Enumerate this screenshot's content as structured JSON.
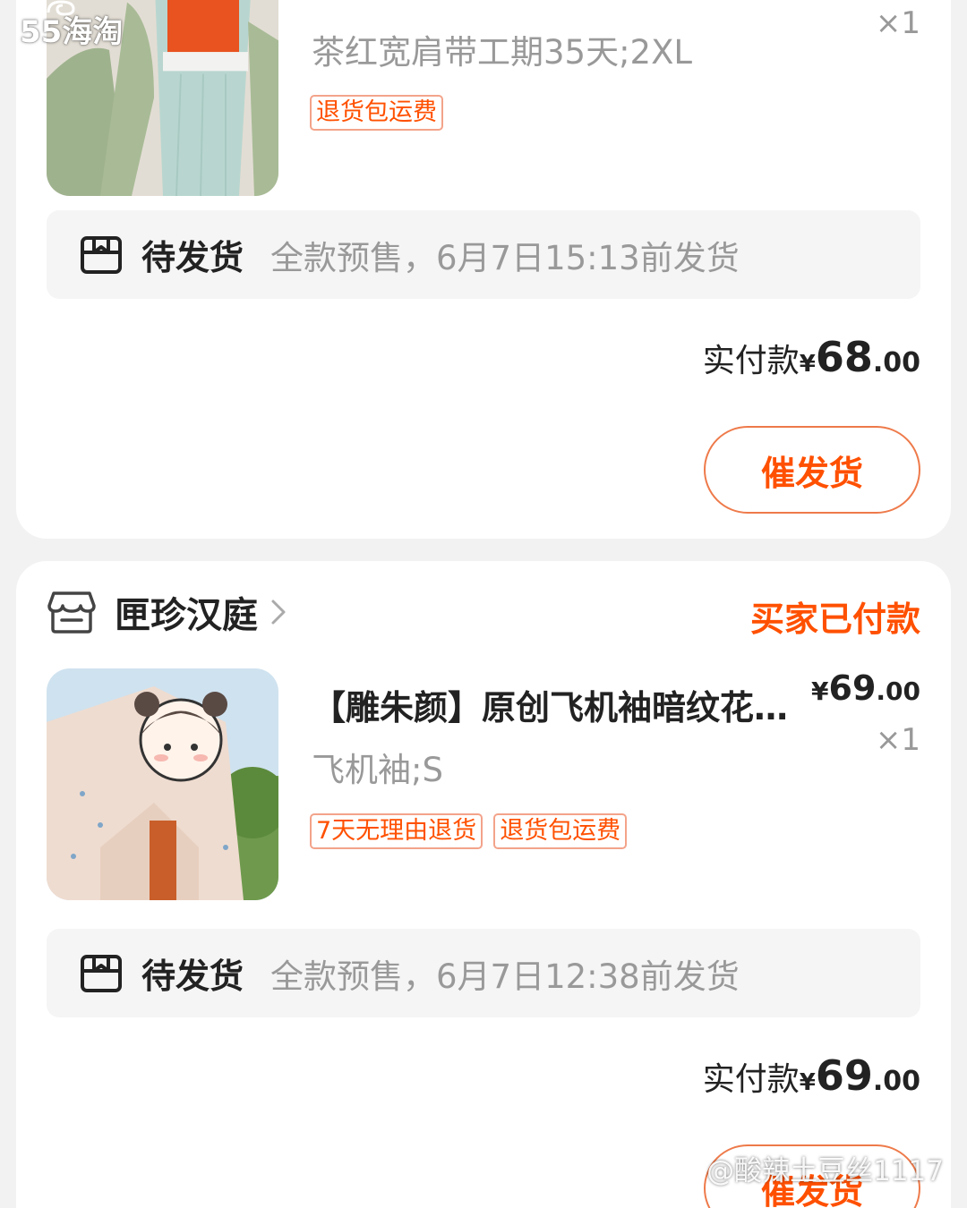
{
  "colors": {
    "accent": "#ff5000",
    "page_bg": "#f2f2f2",
    "muted": "#999999"
  },
  "orders": [
    {
      "product": {
        "sku": "茶红宽肩带工期35天;2XL",
        "qty": "×1",
        "tags": [
          "退货包运费"
        ]
      },
      "shipping": {
        "icon": "package-box-icon",
        "status": "待发货",
        "note": "全款预售，6月7日15:13前发货"
      },
      "payment": {
        "label": "实付款",
        "currency": "¥",
        "amount_int": "68",
        "amount_dec": ".00"
      },
      "action": "催发货"
    },
    {
      "shop": {
        "icon": "store-icon",
        "name": "匣珍汉庭"
      },
      "order_status": "买家已付款",
      "product": {
        "title": "【雕朱颜】原创飞机袖暗纹花…",
        "price_currency": "¥",
        "price_int": "69",
        "price_dec": ".00",
        "sku": "飞机袖;S",
        "qty": "×1",
        "tags": [
          "7天无理由退货",
          "退货包运费"
        ]
      },
      "shipping": {
        "icon": "package-box-icon",
        "status": "待发货",
        "note": "全款预售，6月7日12:38前发货"
      },
      "payment": {
        "label": "实付款",
        "currency": "¥",
        "amount_int": "69",
        "amount_dec": ".00"
      },
      "action": "催发货"
    }
  ],
  "watermarks": {
    "logo_text": "55海淘",
    "user": "@酸辣土豆丝1117"
  }
}
